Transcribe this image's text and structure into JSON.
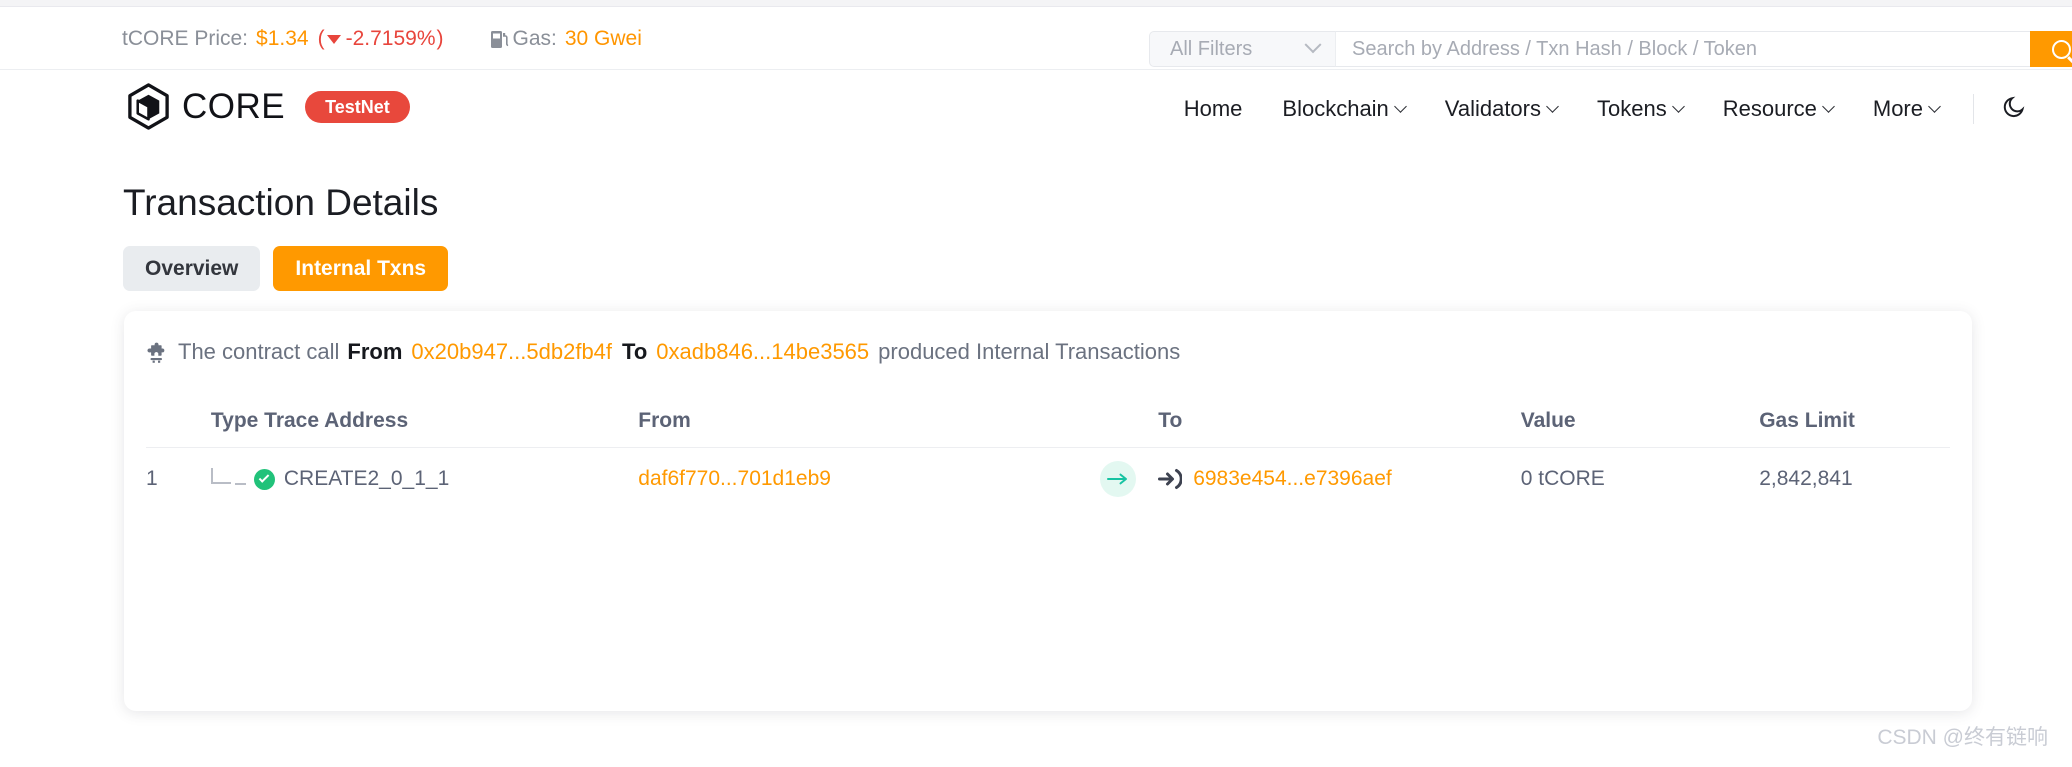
{
  "ticker": {
    "price_label": "tCORE Price:",
    "price_value": "$1.34",
    "paren_open": "(",
    "change_pct": "-2.7159%",
    "paren_close": ")",
    "gas_label": "Gas:",
    "gas_value": "30 Gwei",
    "gas_icon": "gas-pump-icon",
    "caret_icon": "caret-down-icon"
  },
  "search": {
    "filter_label": "All Filters",
    "filter_chevron_icon": "chevron-down-icon",
    "placeholder": "Search by Address / Txn Hash / Block / Token",
    "value": "",
    "button_icon": "search-icon"
  },
  "header": {
    "logo_icon": "core-hexagon-logo-icon",
    "logo_text": "CORE",
    "network_badge": "TestNet",
    "nav": [
      {
        "label": "Home",
        "has_chevron": false
      },
      {
        "label": "Blockchain",
        "has_chevron": true
      },
      {
        "label": "Validators",
        "has_chevron": true
      },
      {
        "label": "Tokens",
        "has_chevron": true
      },
      {
        "label": "Resource",
        "has_chevron": true
      },
      {
        "label": "More",
        "has_chevron": true
      }
    ],
    "theme_toggle_icon": "moon-icon"
  },
  "page": {
    "title": "Transaction Details",
    "tabs": [
      {
        "label": "Overview",
        "active": false
      },
      {
        "label": "Internal Txns",
        "active": true
      }
    ]
  },
  "card": {
    "icon": "puzzle-piece-icon",
    "lead_text": "The contract call",
    "from_label": "From",
    "from_address": "0x20b947...5db2fb4f",
    "to_label": "To",
    "to_address": "0xadb846...14be3565",
    "trailing_text": "produced Internal Transactions"
  },
  "table": {
    "columns": [
      "Type Trace Address",
      "From",
      "To",
      "Value",
      "Gas Limit"
    ],
    "rows": [
      {
        "index": "1",
        "tree_icon": "tree-branch-icon",
        "status_icon": "check-circle-icon",
        "type_trace_address": "CREATE2_0_1_1",
        "from": "daf6f770...701d1eb9",
        "arrow_icon": "arrow-right-icon",
        "to_icon": "sign-in-icon",
        "to": "6983e454...e7396aef",
        "value": "0 tCORE",
        "gas_limit": "2,842,841"
      }
    ]
  },
  "watermark": "CSDN @终有链响",
  "colors": {
    "accent_orange": "#ff9900",
    "badge_red": "#e8483c",
    "change_red": "#e8453c",
    "status_green": "#21c27a",
    "muted_text": "#6b7280"
  }
}
